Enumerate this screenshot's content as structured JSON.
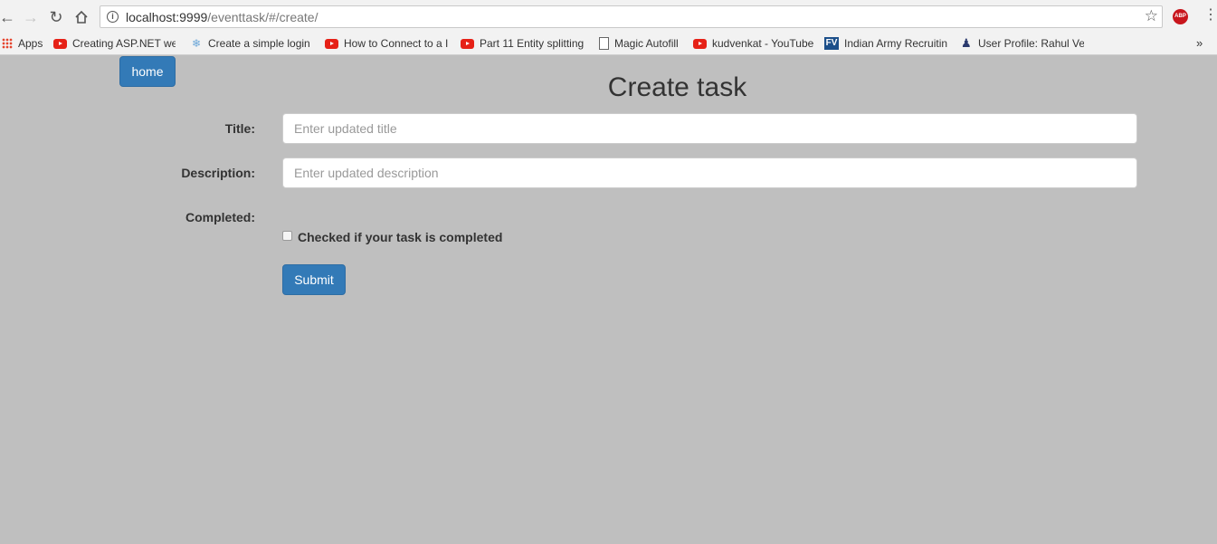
{
  "browser": {
    "url_host": "localhost:9999",
    "url_path": "/eventtask/#/create/",
    "icons": {
      "back": "back-arrow-icon",
      "forward": "forward-arrow-icon",
      "reload": "reload-icon",
      "home": "home-icon",
      "info": "info-icon",
      "star": "star-icon",
      "adblock": "adblock-plus-icon",
      "menu": "kebab-menu-icon"
    },
    "adblock_label": "ABP"
  },
  "bookmarks": [
    {
      "label": "Apps",
      "icon": "apps-grid-icon"
    },
    {
      "label": "Creating ASP.NET wel",
      "icon": "youtube-icon"
    },
    {
      "label": "Create a simple login",
      "icon": "water-drop-icon"
    },
    {
      "label": "How to Connect to a I",
      "icon": "youtube-icon"
    },
    {
      "label": "Part 11 Entity splitting",
      "icon": "youtube-icon"
    },
    {
      "label": "Magic Autofill",
      "icon": "document-icon"
    },
    {
      "label": "kudvenkat - YouTube",
      "icon": "youtube-icon"
    },
    {
      "label": "Indian Army Recruitin",
      "icon": "fv-icon",
      "icon_text": "FV"
    },
    {
      "label": "User Profile: Rahul Ve",
      "icon": "user-badge-icon"
    }
  ],
  "page": {
    "home_button": "home",
    "title": "Create task",
    "form": {
      "title_label": "Title:",
      "title_placeholder": "Enter updated title",
      "description_label": "Description:",
      "description_placeholder": "Enter updated description",
      "completed_label": "Completed:",
      "completed_checkbox_text": "Checked if your task is completed",
      "completed_checked": false,
      "submit_label": "Submit"
    }
  },
  "colors": {
    "page_background": "#bfbfbf",
    "primary_button": "#337ab7",
    "chrome_background": "#f2f2f2"
  }
}
